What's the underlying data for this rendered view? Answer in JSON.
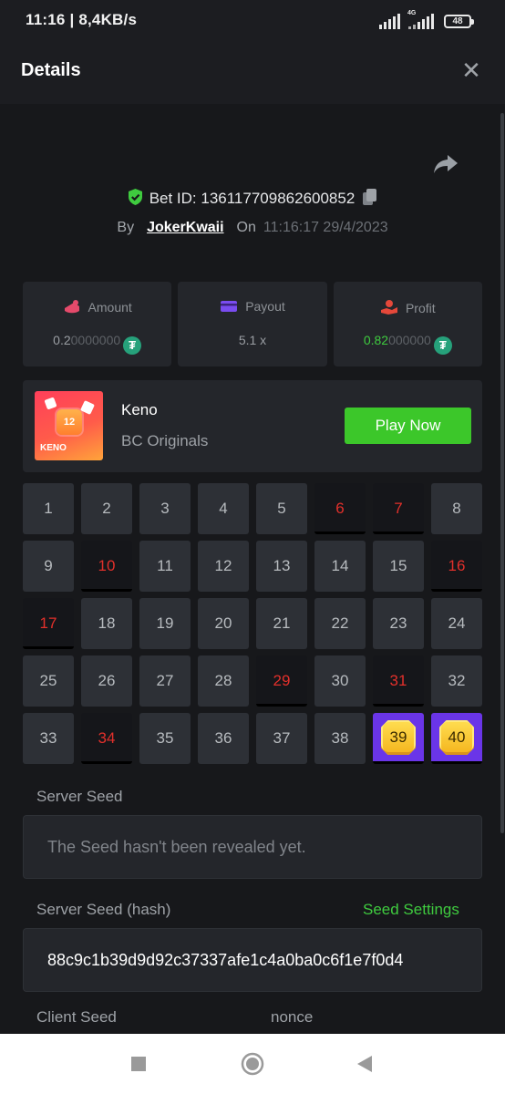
{
  "status_bar": {
    "time": "11:16 | 8,4KB/s",
    "network": "4G",
    "battery": "48"
  },
  "header": {
    "title": "Details",
    "close_icon": "close-icon"
  },
  "bet": {
    "id_label": "Bet ID: 136117709862600852",
    "by_label": "By",
    "username": "JokerKwaii",
    "on_label": "On",
    "timestamp": "11:16:17 29/4/2023"
  },
  "stats": {
    "amount": {
      "label": "Amount",
      "value_main": "0.2",
      "value_dim": "0000000",
      "icon": "amount-icon"
    },
    "payout": {
      "label": "Payout",
      "value": "5.1 x",
      "icon": "payout-icon"
    },
    "profit": {
      "label": "Profit",
      "value_main": "0.82",
      "value_dim": "000000",
      "icon": "profit-icon"
    }
  },
  "game": {
    "name": "Keno",
    "provider": "BC Originals",
    "thumb_number": "12",
    "thumb_tag": "KENO",
    "play_label": "Play Now"
  },
  "grid": {
    "numbers": [
      1,
      2,
      3,
      4,
      5,
      6,
      7,
      8,
      9,
      10,
      11,
      12,
      13,
      14,
      15,
      16,
      17,
      18,
      19,
      20,
      21,
      22,
      23,
      24,
      25,
      26,
      27,
      28,
      29,
      30,
      31,
      32,
      33,
      34,
      35,
      36,
      37,
      38,
      39,
      40
    ],
    "drawn": [
      6,
      7,
      10,
      16,
      17,
      29,
      31,
      34
    ],
    "hits": [
      39,
      40
    ]
  },
  "seeds": {
    "server_seed_label": "Server Seed",
    "server_seed_value": "The Seed hasn't been revealed yet.",
    "server_hash_label": "Server Seed (hash)",
    "seed_settings_label": "Seed Settings",
    "server_hash_value": "88c9c1b39d9d92c37337afe1c4a0ba0c6f1e7f0d4",
    "client_seed_label": "Client Seed",
    "nonce_label": "nonce"
  },
  "colors": {
    "accent_green": "#3cc72a",
    "hit_red": "#e2302b",
    "win_purple": "#6a35e8"
  }
}
